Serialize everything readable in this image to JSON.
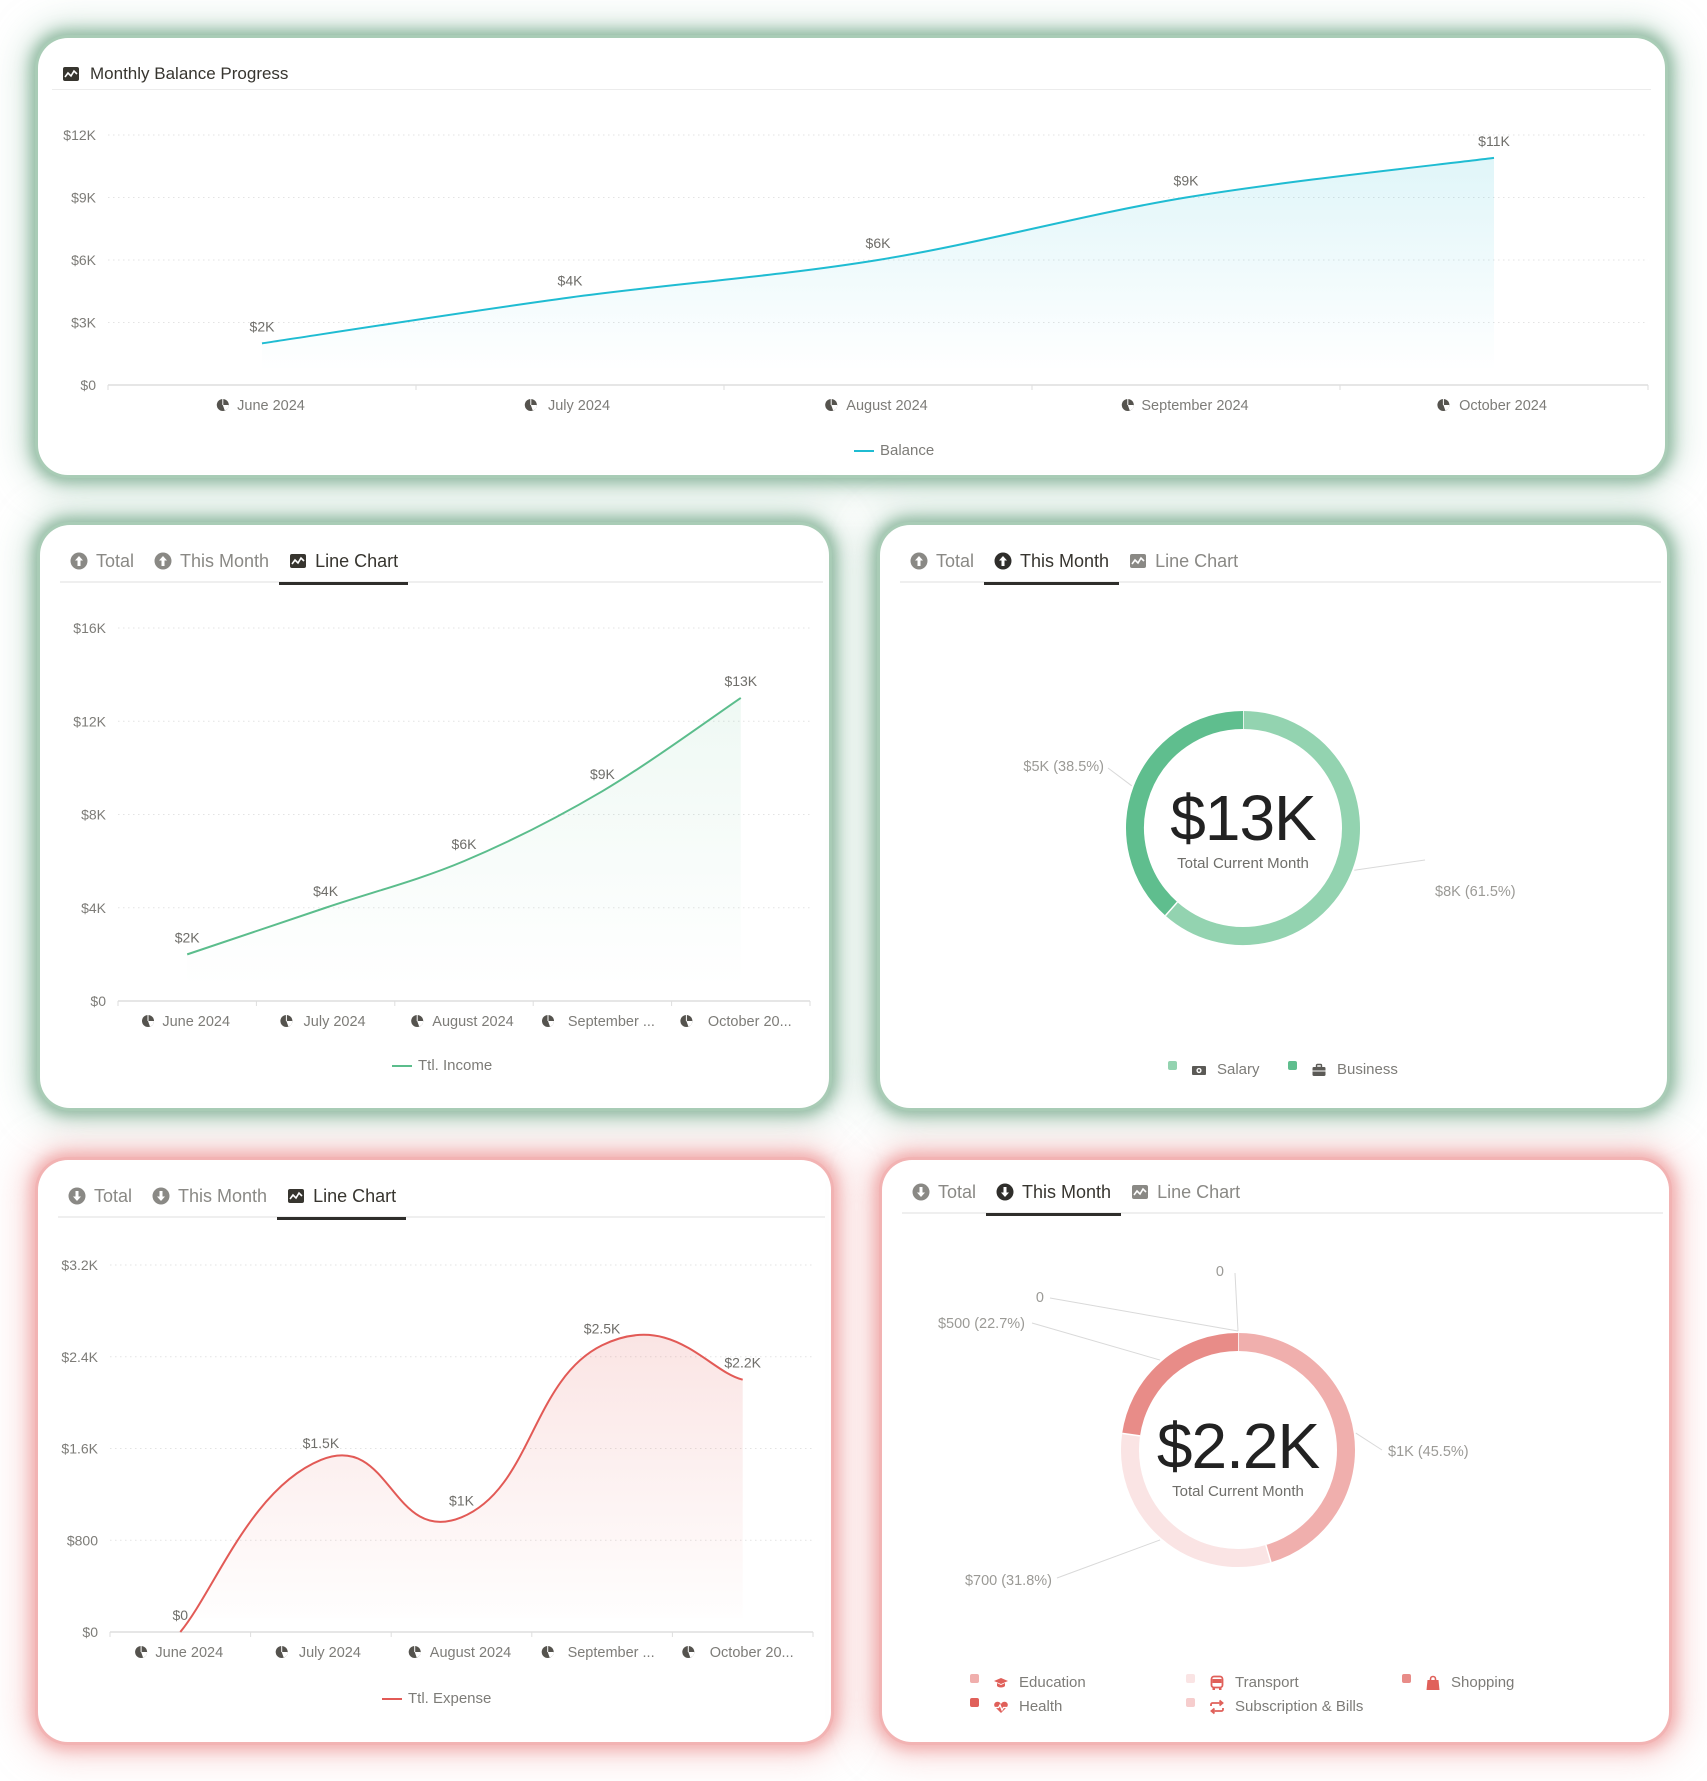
{
  "balance_card": {
    "title": "Monthly Balance Progress",
    "title_icon": "line-chart-icon",
    "legend": "Balance",
    "color": "#1fbcd2"
  },
  "income_chart_card": {
    "tabs": [
      {
        "label": "Total",
        "icon": "arrow-up-circle-icon",
        "active": false
      },
      {
        "label": "This Month",
        "icon": "arrow-up-circle-icon",
        "active": false
      },
      {
        "label": "Line Chart",
        "icon": "line-chart-icon",
        "active": true
      }
    ],
    "legend": "Ttl. Income",
    "color": "#5bbd8c"
  },
  "income_donut_card": {
    "tabs": [
      {
        "label": "Total",
        "icon": "arrow-up-circle-icon",
        "active": false
      },
      {
        "label": "This Month",
        "icon": "arrow-up-circle-icon",
        "active": true
      },
      {
        "label": "Line Chart",
        "icon": "line-chart-icon",
        "active": false
      }
    ],
    "center_value": "$13K",
    "center_label": "Total Current Month"
  },
  "expense_chart_card": {
    "tabs": [
      {
        "label": "Total",
        "icon": "arrow-down-circle-icon",
        "active": false
      },
      {
        "label": "This Month",
        "icon": "arrow-down-circle-icon",
        "active": false
      },
      {
        "label": "Line Chart",
        "icon": "line-chart-icon",
        "active": true
      }
    ],
    "legend": "Ttl. Expense",
    "color": "#e25a56"
  },
  "expense_donut_card": {
    "tabs": [
      {
        "label": "Total",
        "icon": "arrow-down-circle-icon",
        "active": false
      },
      {
        "label": "This Month",
        "icon": "arrow-down-circle-icon",
        "active": true
      },
      {
        "label": "Line Chart",
        "icon": "line-chart-icon",
        "active": false
      }
    ],
    "center_value": "$2.2K",
    "center_label": "Total Current Month"
  },
  "chart_data": [
    {
      "id": "balance",
      "type": "area",
      "title": "Monthly Balance Progress",
      "categories": [
        "June 2024",
        "July 2024",
        "August 2024",
        "September 2024",
        "October 2024"
      ],
      "category_icon": "pie-chart-icon",
      "series": [
        {
          "name": "Balance",
          "values": [
            2000,
            4200,
            6000,
            9000,
            10900
          ],
          "labels": [
            "$2K",
            "$4K",
            "$6K",
            "$9K",
            "$11K"
          ],
          "color": "#1fbcd2"
        }
      ],
      "yticks": [
        "$0",
        "$3K",
        "$6K",
        "$9K",
        "$12K"
      ],
      "ylim": [
        0,
        12000
      ],
      "grid": true,
      "legend": "bottom"
    },
    {
      "id": "income",
      "type": "area",
      "categories": [
        "June 2024",
        "July 2024",
        "August 2024",
        "September ...",
        "October 20..."
      ],
      "category_icon": "pie-chart-icon",
      "series": [
        {
          "name": "Ttl. Income",
          "values": [
            2000,
            4000,
            6000,
            9000,
            13000
          ],
          "labels": [
            "$2K",
            "$4K",
            "$6K",
            "$9K",
            "$13K"
          ],
          "color": "#5bbd8c"
        }
      ],
      "yticks": [
        "$0",
        "$4K",
        "$8K",
        "$12K",
        "$16K"
      ],
      "ylim": [
        0,
        16000
      ],
      "grid": true,
      "legend": "bottom"
    },
    {
      "id": "income_split",
      "type": "pie",
      "slices": [
        {
          "name": "Salary",
          "value": 8000,
          "label": "$8K (61.5%)",
          "percent": 61.5,
          "color": "#93d3b0",
          "icon": "money-icon"
        },
        {
          "name": "Business",
          "value": 5000,
          "label": "$5K (38.5%)",
          "percent": 38.5,
          "color": "#5fbe8e",
          "icon": "briefcase-icon"
        }
      ],
      "total_label": "$13K",
      "legend": "bottom"
    },
    {
      "id": "expense",
      "type": "area",
      "categories": [
        "June 2024",
        "July 2024",
        "August 2024",
        "September ...",
        "October 20..."
      ],
      "category_icon": "pie-chart-icon",
      "series": [
        {
          "name": "Ttl. Expense",
          "values": [
            0,
            1500,
            1000,
            2500,
            2200
          ],
          "labels": [
            "$0",
            "$1.5K",
            "$1K",
            "$2.5K",
            "$2.2K"
          ],
          "color": "#e25a56"
        }
      ],
      "yticks": [
        "$0",
        "$800",
        "$1.6K",
        "$2.4K",
        "$3.2K"
      ],
      "ylim": [
        0,
        3200
      ],
      "grid": true,
      "legend": "bottom"
    },
    {
      "id": "expense_split",
      "type": "pie",
      "slices": [
        {
          "name": "Education",
          "value": 1000,
          "label": "$1K (45.5%)",
          "percent": 45.5,
          "color": "#f0afad",
          "icon": "graduation-cap-icon"
        },
        {
          "name": "Transport",
          "value": 700,
          "label": "$700 (31.8%)",
          "percent": 31.8,
          "color": "#fae4e4",
          "icon": "bus-icon"
        },
        {
          "name": "Shopping",
          "value": 500,
          "label": "$500 (22.7%)",
          "percent": 22.7,
          "color": "#e88c88",
          "icon": "shopping-bag-icon"
        },
        {
          "name": "Health",
          "value": 0,
          "label": "0",
          "percent": 0,
          "color": "#e0605a",
          "icon": "heart-pulse-icon"
        },
        {
          "name": "Subscription & Bills",
          "value": 0,
          "label": "0",
          "percent": 0,
          "color": "#f6cdcd",
          "icon": "repeat-icon"
        }
      ],
      "total_label": "$2.2K",
      "legend": "bottom"
    }
  ]
}
